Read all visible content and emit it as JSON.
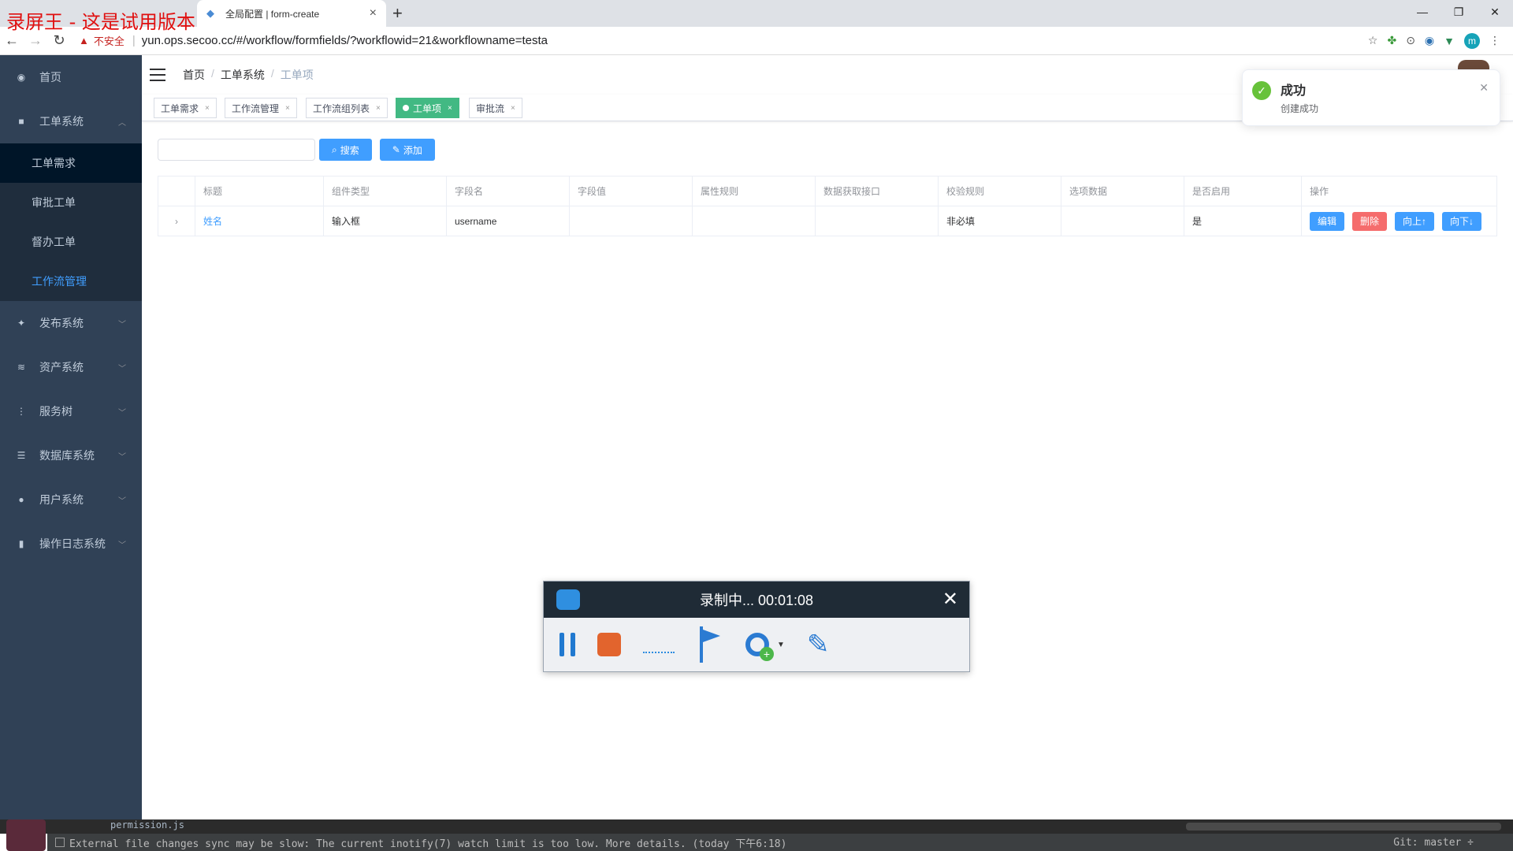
{
  "browser": {
    "watermark": "录屏王 - 这是试用版本",
    "tab_title": "全局配置 | form-create",
    "new_tab": "+",
    "url_warning": "不安全",
    "url": "yun.ops.secoo.cc/#/workflow/formfields/?workflowid=21&workflowname=testa",
    "profile_initial": "m"
  },
  "sidebar": {
    "items": [
      {
        "label": "首页",
        "icon": "dashboard-icon"
      },
      {
        "label": "工单系统",
        "icon": "clipboard-icon",
        "expanded": true
      },
      {
        "label": "发布系统",
        "icon": "rocket-icon"
      },
      {
        "label": "资产系统",
        "icon": "layers-icon"
      },
      {
        "label": "服务树",
        "icon": "tree-icon"
      },
      {
        "label": "数据库系统",
        "icon": "database-icon"
      },
      {
        "label": "用户系统",
        "icon": "user-icon"
      },
      {
        "label": "操作日志系统",
        "icon": "file-icon"
      }
    ],
    "subitems": [
      "工单需求",
      "审批工单",
      "督办工单",
      "工作流管理"
    ]
  },
  "breadcrumb": [
    "首页",
    "工单系统",
    "工单项"
  ],
  "tags": [
    "工单需求",
    "工作流管理",
    "工作流组列表",
    "工单项",
    "审批流"
  ],
  "toolbar": {
    "search_label": "搜索",
    "add_label": "添加"
  },
  "table": {
    "headers": [
      "标题",
      "组件类型",
      "字段名",
      "字段值",
      "属性规则",
      "数据获取接口",
      "校验规则",
      "选项数据",
      "是否启用",
      "操作"
    ],
    "rows": [
      {
        "title": "姓名",
        "type": "输入框",
        "field": "username",
        "value": "",
        "attr": "",
        "api": "",
        "validate": "非必填",
        "options": "",
        "enabled": "是"
      }
    ],
    "actions": {
      "edit": "编辑",
      "delete": "删除",
      "up": "向上↑",
      "down": "向下↓"
    }
  },
  "notification": {
    "title": "成功",
    "message": "创建成功"
  },
  "recorder": {
    "status": "录制中... 00:01:08"
  },
  "ide": {
    "file": "permission.js",
    "status": "External file changes sync may be slow: The current inotify(7) watch limit is too low. More details. (today 下午6:18)",
    "git": "Git: master ÷"
  },
  "colors": {
    "sidebar_bg": "#304156",
    "primary": "#409eff",
    "danger": "#f56c6c",
    "active_tag": "#42b983",
    "success": "#67c23a"
  }
}
